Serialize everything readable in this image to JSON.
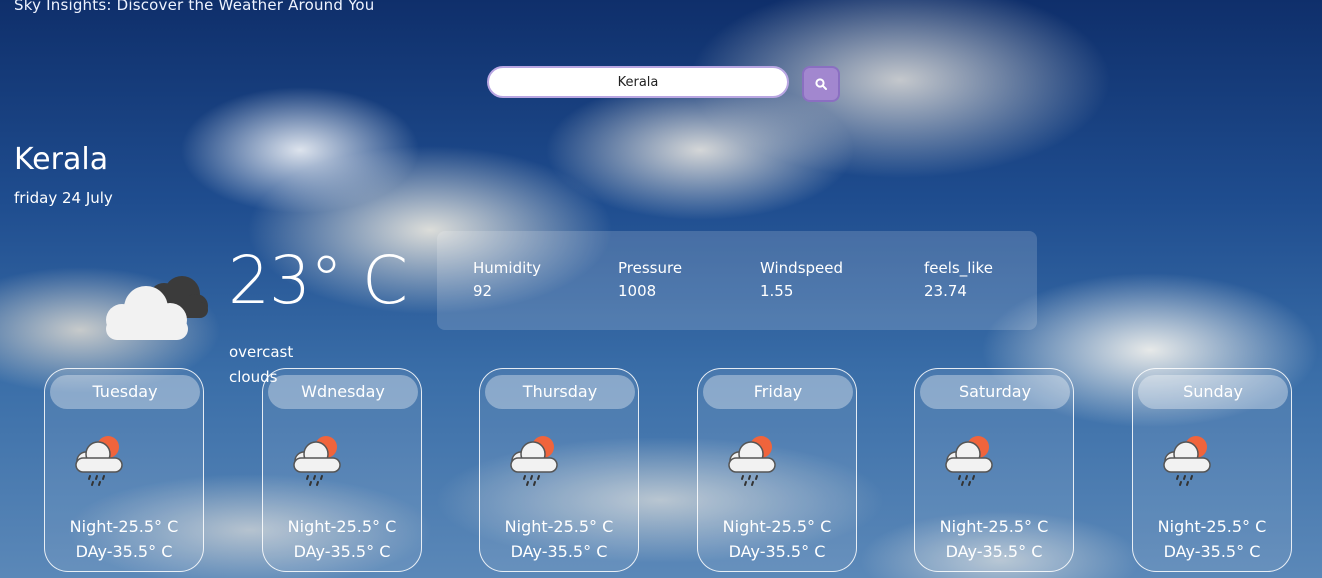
{
  "header": {
    "title": "Sky Insights: Discover the Weather Around You"
  },
  "search": {
    "value": "Kerala",
    "button_icon": "search-icon"
  },
  "current": {
    "city": "Kerala",
    "date": "friday 24 July",
    "temperature": "23° C",
    "description": "overcast clouds",
    "icon": "cloudy-icon"
  },
  "stats": [
    {
      "label": "Humidity",
      "value": "92"
    },
    {
      "label": "Pressure",
      "value": "1008"
    },
    {
      "label": "Windspeed",
      "value": "1.55"
    },
    {
      "label": "feels_like",
      "value": "23.74"
    }
  ],
  "forecast": [
    {
      "day": "Tuesday",
      "night": "Night-25.5° C",
      "dayTemp": "DAy-35.5° C",
      "icon": "rain-sun-cloud-icon"
    },
    {
      "day": "Wdnesday",
      "night": "Night-25.5° C",
      "dayTemp": "DAy-35.5° C",
      "icon": "rain-sun-cloud-icon"
    },
    {
      "day": "Thursday",
      "night": "Night-25.5° C",
      "dayTemp": "DAy-35.5° C",
      "icon": "rain-sun-cloud-icon"
    },
    {
      "day": "Friday",
      "night": "Night-25.5° C",
      "dayTemp": "DAy-35.5° C",
      "icon": "rain-sun-cloud-icon"
    },
    {
      "day": "Saturday",
      "night": "Night-25.5° C",
      "dayTemp": "DAy-35.5° C",
      "icon": "rain-sun-cloud-icon"
    },
    {
      "day": "Sunday",
      "night": "Night-25.5° C",
      "dayTemp": "DAy-35.5° C",
      "icon": "rain-sun-cloud-icon"
    }
  ],
  "colors": {
    "accent": "#a287cf",
    "search_border": "#b9a6e2",
    "sun": "#f0643c"
  }
}
